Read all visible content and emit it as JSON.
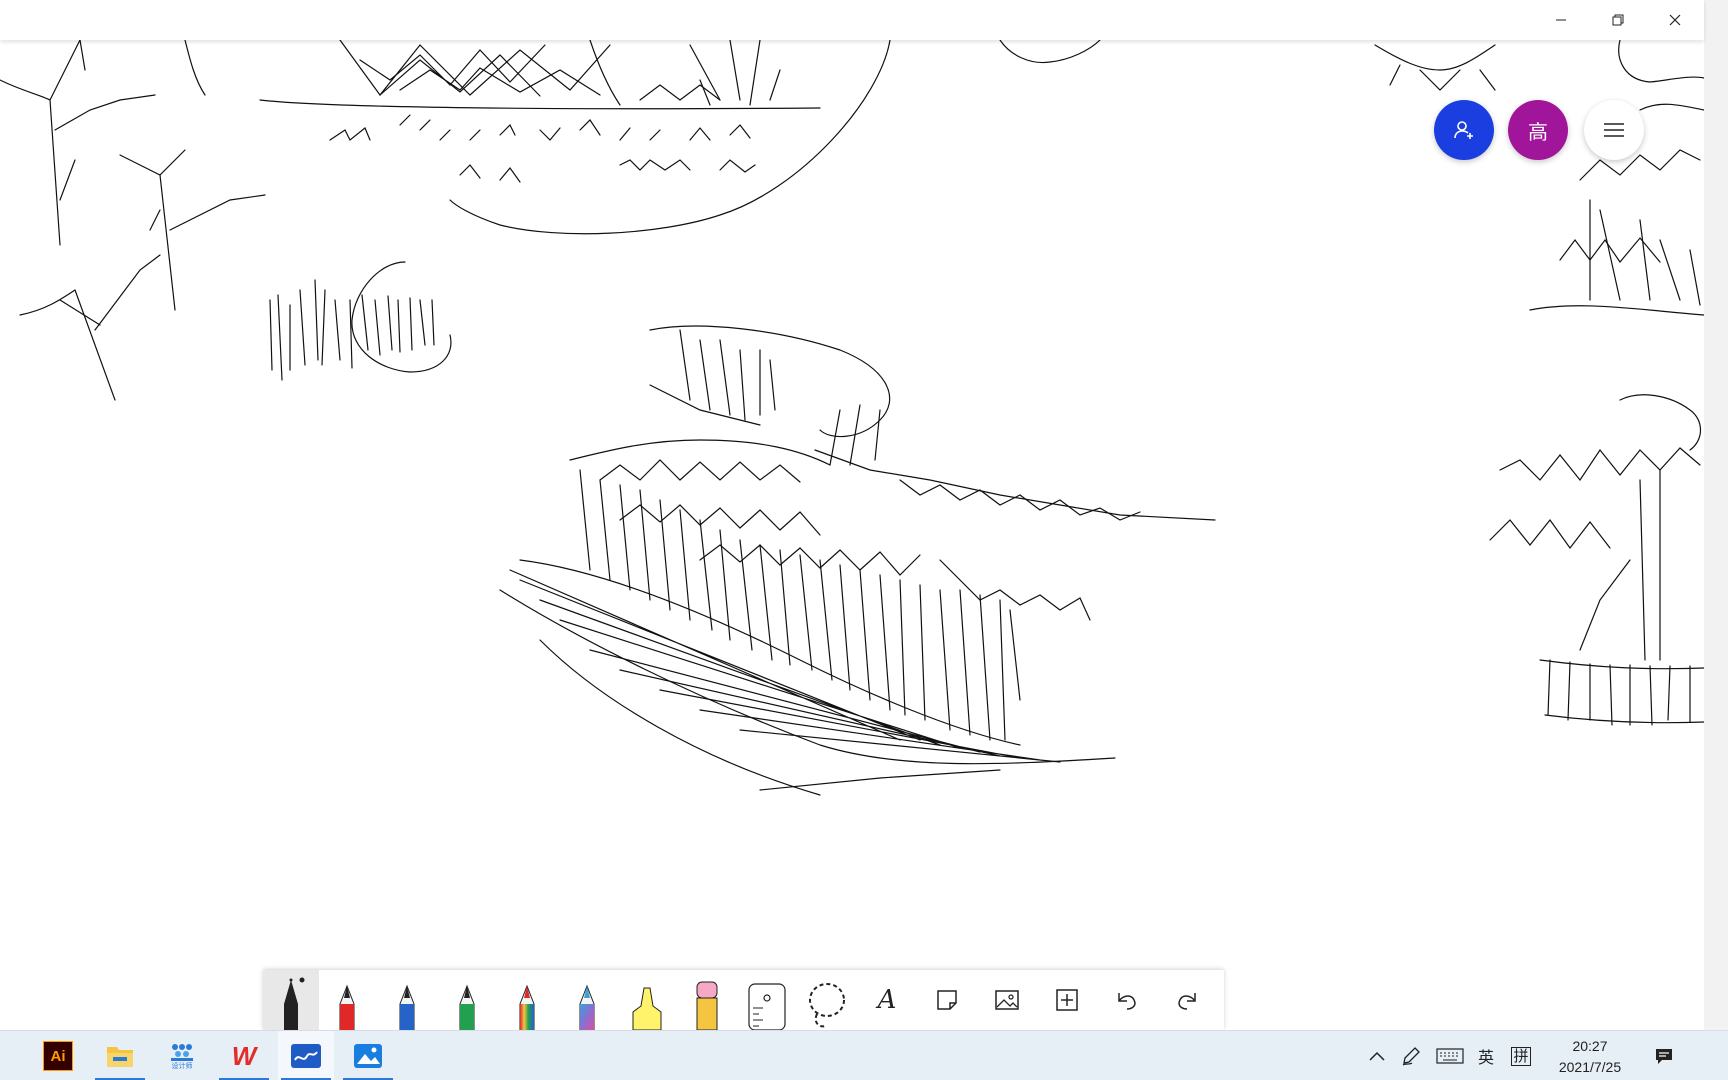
{
  "title_bar": {
    "title": ""
  },
  "window_controls": [
    "minimize-icon",
    "restore-icon",
    "close-icon"
  ],
  "collab": {
    "avatar_initial": "高",
    "share_icon": "add-person-icon",
    "menu_icon": "hamburger-menu-icon",
    "share_color": "#1a3ee0",
    "avatar_color": "#a1159a"
  },
  "toolbar": {
    "tools": [
      {
        "name": "ballpoint-pen-black",
        "color": "#111111",
        "selected": true
      },
      {
        "name": "ballpoint-pen-red",
        "color": "#e02828"
      },
      {
        "name": "ballpoint-pen-blue",
        "color": "#2563c9"
      },
      {
        "name": "ballpoint-pen-green",
        "color": "#22a050"
      },
      {
        "name": "pencil-rainbow",
        "color": "rainbow"
      },
      {
        "name": "pencil-galaxy",
        "color": "galaxy"
      },
      {
        "name": "highlighter-yellow",
        "color": "#fff36b"
      },
      {
        "name": "eraser",
        "color": "#f6a8c6"
      },
      {
        "name": "ruler-icon"
      },
      {
        "name": "lasso-select-icon"
      },
      {
        "name": "text-icon",
        "label": "A"
      },
      {
        "name": "sticky-note-icon"
      },
      {
        "name": "image-icon"
      },
      {
        "name": "add-icon"
      },
      {
        "name": "undo-icon"
      },
      {
        "name": "redo-icon"
      }
    ]
  },
  "taskbar": {
    "apps": [
      {
        "name": "illustrator-icon",
        "label": "Ai"
      },
      {
        "name": "file-explorer-icon"
      },
      {
        "name": "design-app-icon",
        "label": "设计师"
      },
      {
        "name": "wps-office-icon",
        "label": "W"
      },
      {
        "name": "whiteboard-icon",
        "active": true
      },
      {
        "name": "photos-icon"
      }
    ],
    "tray": {
      "chevron_icon": "chevron-up-icon",
      "pen_icon": "pen-workspace-icon",
      "keyboard_icon": "touch-keyboard-icon",
      "ime_mode": "英",
      "ime_type": "拼",
      "time": "20:27",
      "date": "2021/7/25",
      "notification_icon": "notification-icon"
    }
  }
}
